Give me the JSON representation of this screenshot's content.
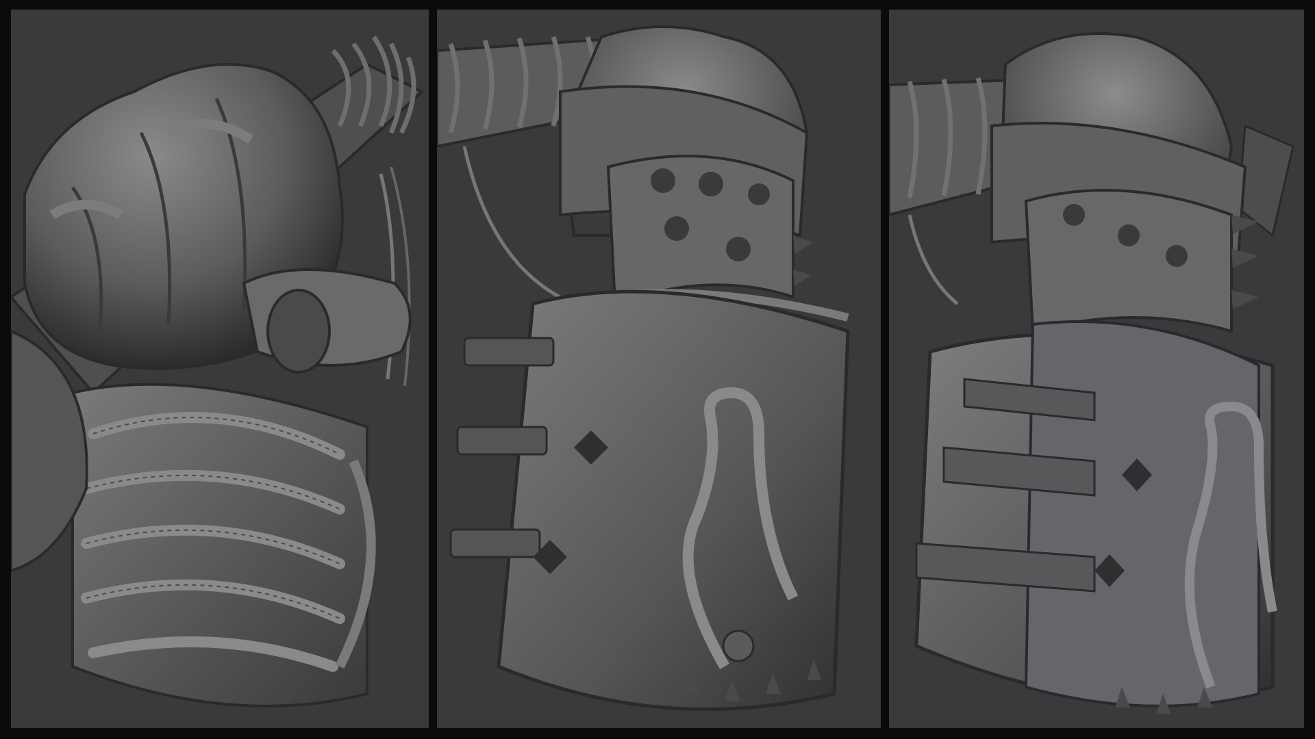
{
  "panels": [
    {
      "view": "hand-grip-closeup"
    },
    {
      "view": "gauntlet-side"
    },
    {
      "view": "gauntlet-three-quarter"
    }
  ],
  "colors": {
    "background": "#0b0b0b",
    "panel": "#3a3a3c",
    "clay_light": "#8c8c8e",
    "clay_mid": "#5f5f61",
    "clay_dark": "#2a2a2c"
  }
}
